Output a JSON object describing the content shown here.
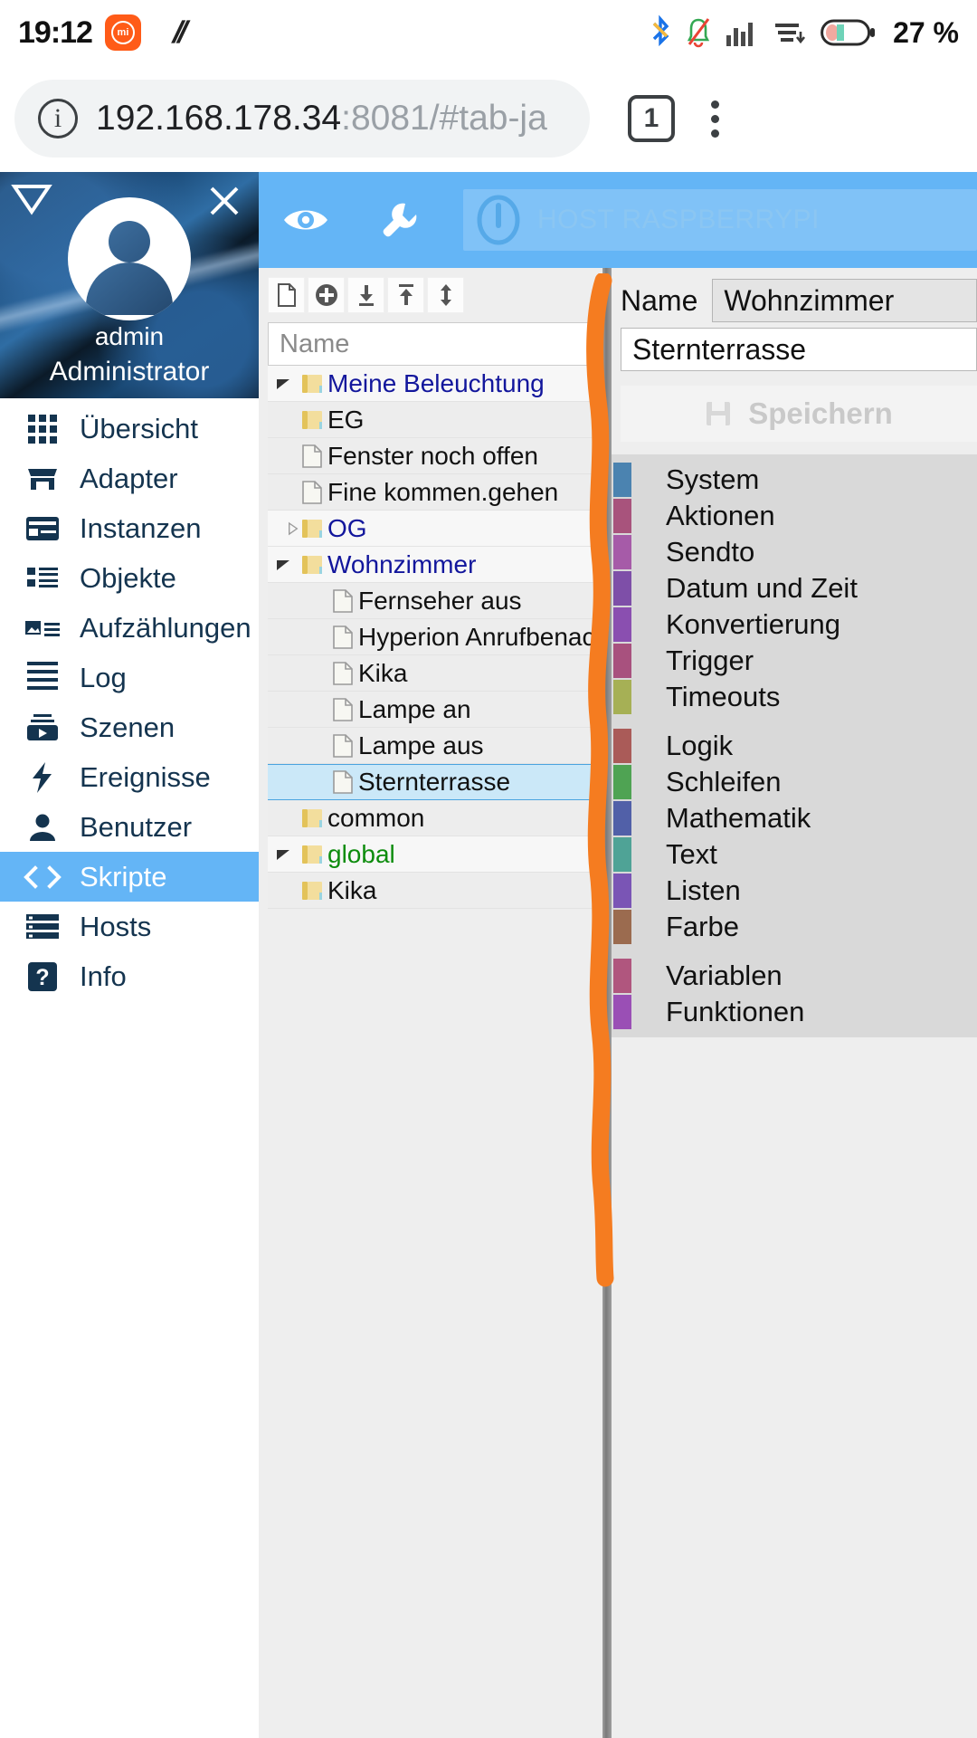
{
  "status_bar": {
    "time": "19:12",
    "carrier_badge": "mi",
    "vpn_icon": "slash-slash-icon",
    "icons": [
      "bluetooth-icon",
      "notification-muted-icon",
      "signal-bars-icon",
      "data-saver-icon",
      "battery-icon"
    ],
    "battery_percent": "27 %"
  },
  "browser": {
    "security_icon": "info-circle-icon",
    "url_host": "192.168.178.34",
    "url_rest": ":8081/#tab-ja",
    "tab_count": "1",
    "menu_icon": "kebab-menu-icon"
  },
  "drawer": {
    "collapse_icon": "collapse-triangle-icon",
    "close_icon": "close-icon",
    "avatar_icon": "user-avatar-icon",
    "username": "admin",
    "role": "Administrator",
    "items": [
      {
        "label": "Übersicht",
        "icon": "grid-icon",
        "active": false
      },
      {
        "label": "Adapter",
        "icon": "shop-icon",
        "active": false
      },
      {
        "label": "Instanzen",
        "icon": "card-icon",
        "active": false
      },
      {
        "label": "Objekte",
        "icon": "list-icon",
        "active": false
      },
      {
        "label": "Aufzählungen",
        "icon": "image-list-icon",
        "active": false
      },
      {
        "label": "Log",
        "icon": "lines-icon",
        "active": false
      },
      {
        "label": "Szenen",
        "icon": "play-box-icon",
        "active": false
      },
      {
        "label": "Ereignisse",
        "icon": "bolt-icon",
        "active": false
      },
      {
        "label": "Benutzer",
        "icon": "person-icon",
        "active": false
      },
      {
        "label": "Skripte",
        "icon": "code-icon",
        "active": true
      },
      {
        "label": "Hosts",
        "icon": "server-icon",
        "active": false
      },
      {
        "label": "Info",
        "icon": "question-icon",
        "active": false
      }
    ]
  },
  "appbar": {
    "eye_icon": "eye-icon",
    "wrench_icon": "wrench-icon",
    "host_power_icon": "power-info-icon",
    "host_label": "HOST RASPBERRYPI"
  },
  "tree_toolbar": [
    {
      "icon": "new-file-icon"
    },
    {
      "icon": "add-circle-icon"
    },
    {
      "icon": "import-icon"
    },
    {
      "icon": "export-icon"
    },
    {
      "icon": "expand-collapse-icon"
    }
  ],
  "tree": {
    "header": "Name",
    "rows": [
      {
        "label": "Meine Beleuchtung",
        "type": "folder",
        "indent": 0,
        "twist": "down",
        "selected": false,
        "color": "blue"
      },
      {
        "label": "EG",
        "type": "folder",
        "indent": 1,
        "twist": "none",
        "selected": false,
        "color": "plain"
      },
      {
        "label": "Fenster noch offen",
        "type": "file",
        "indent": 1,
        "twist": "none",
        "selected": false,
        "color": "plain"
      },
      {
        "label": "Fine kommen.gehen",
        "type": "file",
        "indent": 1,
        "twist": "none",
        "selected": false,
        "color": "plain"
      },
      {
        "label": "OG",
        "type": "folder",
        "indent": 0,
        "twist": "right",
        "selected": false,
        "color": "blue"
      },
      {
        "label": "Wohnzimmer",
        "type": "folder",
        "indent": 0,
        "twist": "down",
        "selected": false,
        "color": "blue"
      },
      {
        "label": "Fernseher aus",
        "type": "file",
        "indent": 2,
        "twist": "none",
        "selected": false,
        "color": "plain"
      },
      {
        "label": "Hyperion Anrufbenachrichtig",
        "type": "file",
        "indent": 2,
        "twist": "none",
        "selected": false,
        "color": "plain"
      },
      {
        "label": "Kika",
        "type": "file",
        "indent": 2,
        "twist": "none",
        "selected": false,
        "color": "plain"
      },
      {
        "label": "Lampe an",
        "type": "file",
        "indent": 2,
        "twist": "none",
        "selected": false,
        "color": "plain"
      },
      {
        "label": "Lampe aus",
        "type": "file",
        "indent": 2,
        "twist": "none",
        "selected": false,
        "color": "plain"
      },
      {
        "label": "Sternterrasse",
        "type": "file",
        "indent": 2,
        "twist": "none",
        "selected": true,
        "color": "plain"
      },
      {
        "label": "common",
        "type": "folder",
        "indent": 0,
        "twist": "none",
        "selected": false,
        "color": "plain"
      },
      {
        "label": "global",
        "type": "folder",
        "indent": 0,
        "twist": "down",
        "selected": false,
        "color": "green"
      },
      {
        "label": "Kika",
        "type": "folder",
        "indent": 1,
        "twist": "none",
        "selected": false,
        "color": "plain"
      }
    ]
  },
  "annotation": {
    "marker": "orange-hand-drawn-vertical-line"
  },
  "editor": {
    "name_label": "Name",
    "name_value": "Wohnzimmer",
    "script_name": "Sternterrasse",
    "save_icon": "save-disk-icon",
    "save_label": "Speichern",
    "categories": [
      {
        "label": "System",
        "color": "#4b83b0"
      },
      {
        "label": "Aktionen",
        "color": "#a8537c"
      },
      {
        "label": "Sendto",
        "color": "#a65ba8"
      },
      {
        "label": "Datum und Zeit",
        "color": "#7e4fa8"
      },
      {
        "label": "Konvertierung",
        "color": "#8a4fb0"
      },
      {
        "label": "Trigger",
        "color": "#a8517e"
      },
      {
        "label": "Timeouts",
        "color": "#a6b055"
      },
      {
        "gap": true
      },
      {
        "label": "Logik",
        "color": "#aa5b58"
      },
      {
        "label": "Schleifen",
        "color": "#4fa353"
      },
      {
        "label": "Mathematik",
        "color": "#5160a8"
      },
      {
        "label": "Text",
        "color": "#4fa396"
      },
      {
        "label": "Listen",
        "color": "#7a55b5"
      },
      {
        "label": "Farbe",
        "color": "#9b6b4f"
      },
      {
        "gap": true
      },
      {
        "label": "Variablen",
        "color": "#b0567e"
      },
      {
        "label": "Funktionen",
        "color": "#9a4fb5"
      }
    ]
  },
  "colors": {
    "accent": "#64b5f6",
    "drawer_text": "#14344f",
    "selection": "#cbe8f8",
    "marker": "#f57c20"
  }
}
